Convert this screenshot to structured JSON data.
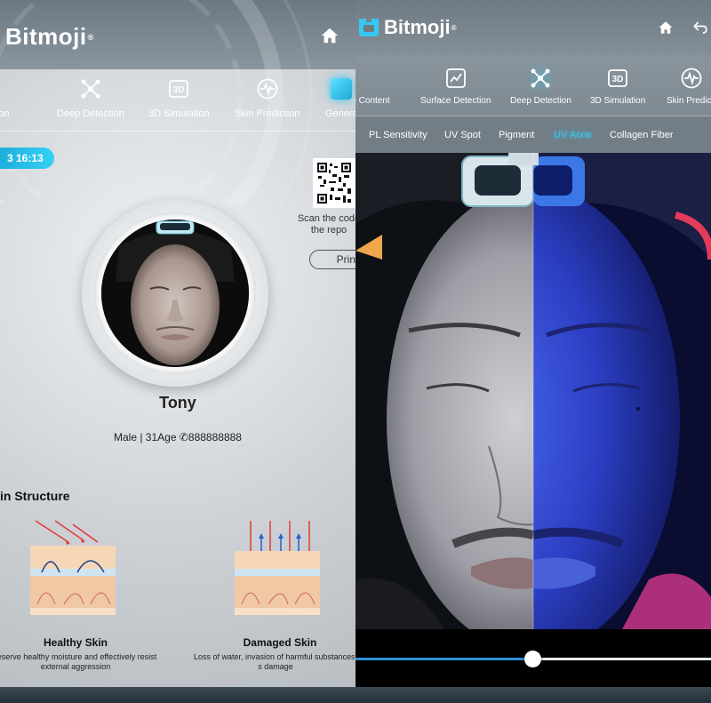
{
  "left": {
    "brand": "Bitmoji",
    "nav": [
      {
        "label": "etection",
        "icon": "skin-detection-icon"
      },
      {
        "label": "Deep Detection",
        "icon": "molecule-icon"
      },
      {
        "label": "3D Simulation",
        "icon": "3d-icon"
      },
      {
        "label": "Skin Prediction",
        "icon": "pulse-icon"
      },
      {
        "label": "Genera",
        "icon": "report-icon"
      }
    ],
    "date": "3 16:13",
    "scan_text": "Scan the code the repo",
    "print_label": "Print",
    "user": {
      "name": "Tony",
      "meta": "Male | 31Age",
      "phone": "888888888"
    },
    "section_title": "in Structure",
    "healthy": {
      "label": "Healthy Skin",
      "desc": "reserve healthy moisture and effectively resist external aggression"
    },
    "damaged": {
      "label": "Damaged Skin",
      "desc": "Loss of water, invasion of harmful substances, s damage"
    }
  },
  "right": {
    "brand": "Bitmoji",
    "nav": [
      {
        "label": "re Content",
        "icon": "content-icon"
      },
      {
        "label": "Surface Detection",
        "icon": "trend-chart-icon"
      },
      {
        "label": "Deep Detection",
        "icon": "molecule-icon",
        "active": true
      },
      {
        "label": "3D Simulation",
        "icon": "3d-icon"
      },
      {
        "label": "Skin Predicti",
        "icon": "pulse-icon"
      }
    ],
    "subtabs": [
      "PL Sensitivity",
      "UV Spot",
      "Pigment",
      "UV Acne",
      "Collagen Fiber"
    ],
    "active_subtab": "UV Acne",
    "slider_value": 0.5
  },
  "colors": {
    "accent": "#36c8f2",
    "uv_blue": "#2b4fd8",
    "track": "#2c8fd6"
  }
}
